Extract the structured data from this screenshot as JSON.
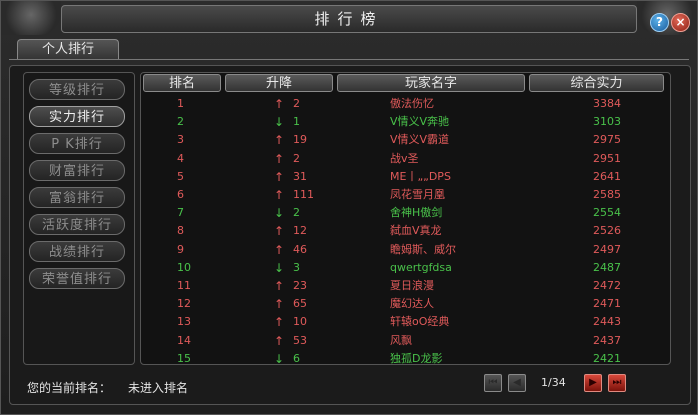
{
  "window": {
    "title": "排行榜"
  },
  "tab": {
    "label": "个人排行"
  },
  "categories": [
    {
      "label": "等级排行",
      "active": false
    },
    {
      "label": "实力排行",
      "active": true
    },
    {
      "label": "P K排行",
      "active": false
    },
    {
      "label": "财富排行",
      "active": false
    },
    {
      "label": "富翁排行",
      "active": false
    },
    {
      "label": "活跃度排行",
      "active": false
    },
    {
      "label": "战绩排行",
      "active": false
    },
    {
      "label": "荣誉值排行",
      "active": false
    }
  ],
  "table": {
    "headers": [
      "排名",
      "升降",
      "玩家名字",
      "综合实力"
    ],
    "rows": [
      {
        "rank": "1",
        "dir": "up",
        "change": "2",
        "name": "傲法伤忆",
        "power": "3384"
      },
      {
        "rank": "2",
        "dir": "down",
        "change": "1",
        "name": "V情义V奔驰",
        "power": "3103"
      },
      {
        "rank": "3",
        "dir": "up",
        "change": "19",
        "name": "V情义V霸道",
        "power": "2975"
      },
      {
        "rank": "4",
        "dir": "up",
        "change": "2",
        "name": "战v圣",
        "power": "2951"
      },
      {
        "rank": "5",
        "dir": "up",
        "change": "31",
        "name": "ME丨„„DPS",
        "power": "2641"
      },
      {
        "rank": "6",
        "dir": "up",
        "change": "111",
        "name": "凤花雪月凰",
        "power": "2585"
      },
      {
        "rank": "7",
        "dir": "down",
        "change": "2",
        "name": "舍神H傲剑",
        "power": "2554"
      },
      {
        "rank": "8",
        "dir": "up",
        "change": "12",
        "name": "弑血V真龙",
        "power": "2526"
      },
      {
        "rank": "9",
        "dir": "up",
        "change": "46",
        "name": "瞻姆斯、威尔",
        "power": "2497"
      },
      {
        "rank": "10",
        "dir": "down",
        "change": "3",
        "name": "qwertgfdsa",
        "power": "2487"
      },
      {
        "rank": "11",
        "dir": "up",
        "change": "23",
        "name": "夏日浪漫",
        "power": "2472"
      },
      {
        "rank": "12",
        "dir": "up",
        "change": "65",
        "name": "魔幻达人",
        "power": "2471"
      },
      {
        "rank": "13",
        "dir": "up",
        "change": "10",
        "name": "轩辕oO经典",
        "power": "2443"
      },
      {
        "rank": "14",
        "dir": "up",
        "change": "53",
        "name": "风飘",
        "power": "2437"
      },
      {
        "rank": "15",
        "dir": "down",
        "change": "6",
        "name": "独孤D龙影",
        "power": "2421"
      }
    ]
  },
  "footer": {
    "current_rank_label": "您的当前排名：",
    "current_rank_value": "未进入排名",
    "page_text": "1/34"
  },
  "icons": {
    "help": "?",
    "close": "×",
    "up_arrow": "↑",
    "down_arrow": "↓",
    "first_page": "⏮",
    "prev_page": "◀",
    "next_page": "▶",
    "last_page": "⏭"
  },
  "colors": {
    "up": "#e05a5a",
    "down": "#49c14a"
  }
}
